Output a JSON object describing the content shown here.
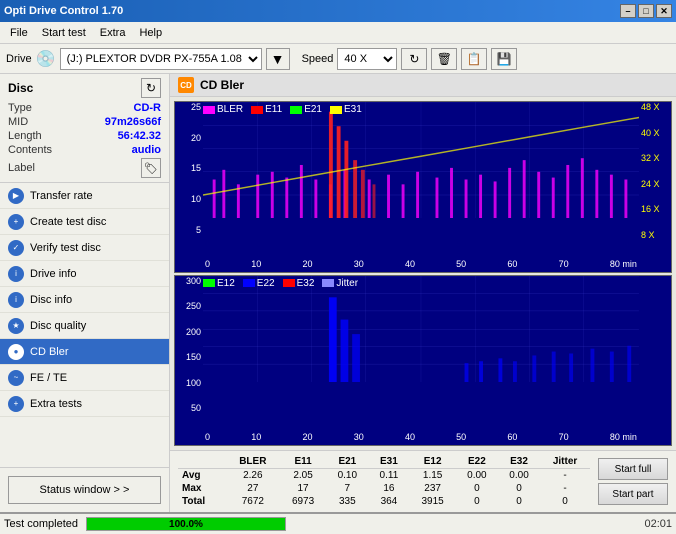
{
  "titleBar": {
    "title": "Opti Drive Control 1.70",
    "minBtn": "–",
    "maxBtn": "□",
    "closeBtn": "✕"
  },
  "menuBar": {
    "items": [
      "File",
      "Start test",
      "Extra",
      "Help"
    ]
  },
  "driveBar": {
    "label": "Drive",
    "driveValue": "(J:)  PLEXTOR DVDR   PX-755A 1.08",
    "speedLabel": "Speed",
    "speedValue": "40 X"
  },
  "disc": {
    "title": "Disc",
    "typeLabel": "Type",
    "typeValue": "CD-R",
    "midLabel": "MID",
    "midValue": "97m26s66f",
    "lengthLabel": "Length",
    "lengthValue": "56:42.32",
    "contentsLabel": "Contents",
    "contentsValue": "audio",
    "labelLabel": "Label"
  },
  "nav": {
    "items": [
      {
        "id": "transfer-rate",
        "label": "Transfer rate",
        "active": false
      },
      {
        "id": "create-test-disc",
        "label": "Create test disc",
        "active": false
      },
      {
        "id": "verify-test-disc",
        "label": "Verify test disc",
        "active": false
      },
      {
        "id": "drive-info",
        "label": "Drive info",
        "active": false
      },
      {
        "id": "disc-info",
        "label": "Disc info",
        "active": false
      },
      {
        "id": "disc-quality",
        "label": "Disc quality",
        "active": false
      },
      {
        "id": "cd-bler",
        "label": "CD Bler",
        "active": true
      },
      {
        "id": "fe-te",
        "label": "FE / TE",
        "active": false
      },
      {
        "id": "extra-tests",
        "label": "Extra tests",
        "active": false
      }
    ]
  },
  "statusWindowBtn": "Status window > >",
  "chart1": {
    "title": "CD Bler",
    "legend": [
      {
        "label": "BLER",
        "color": "#ff00ff"
      },
      {
        "label": "E11",
        "color": "#ff0000"
      },
      {
        "label": "E21",
        "color": "#00ff00"
      },
      {
        "label": "E31",
        "color": "#ffff00"
      }
    ],
    "yAxis": [
      "25",
      "20",
      "15",
      "10",
      "5"
    ],
    "xAxis": [
      "0",
      "10",
      "20",
      "30",
      "40",
      "50",
      "60",
      "70",
      "80 min"
    ],
    "rightAxis": [
      "48 X",
      "40 X",
      "32 X",
      "24 X",
      "16 X",
      "8 X"
    ]
  },
  "chart2": {
    "legend": [
      {
        "label": "E12",
        "color": "#00ff00"
      },
      {
        "label": "E22",
        "color": "#0000ff"
      },
      {
        "label": "E32",
        "color": "#ff0000"
      },
      {
        "label": "Jitter",
        "color": "#8888ff"
      }
    ],
    "yAxis": [
      "300",
      "250",
      "200",
      "150",
      "100",
      "50"
    ],
    "xAxis": [
      "0",
      "10",
      "20",
      "30",
      "40",
      "50",
      "60",
      "70",
      "80 min"
    ]
  },
  "stats": {
    "headers": [
      "",
      "BLER",
      "E11",
      "E21",
      "E31",
      "E12",
      "E22",
      "E32",
      "Jitter"
    ],
    "rows": [
      {
        "label": "Avg",
        "values": [
          "2.26",
          "2.05",
          "0.10",
          "0.11",
          "1.15",
          "0.00",
          "0.00",
          "-"
        ]
      },
      {
        "label": "Max",
        "values": [
          "27",
          "17",
          "7",
          "16",
          "237",
          "0",
          "0",
          "-"
        ]
      },
      {
        "label": "Total",
        "values": [
          "7672",
          "6973",
          "335",
          "364",
          "3915",
          "0",
          "0",
          "0"
        ]
      }
    ],
    "startFullBtn": "Start full",
    "startPartBtn": "Start part"
  },
  "statusBar": {
    "text": "Test completed",
    "progress": 100,
    "progressLabel": "100.0%",
    "time": "02:01"
  }
}
